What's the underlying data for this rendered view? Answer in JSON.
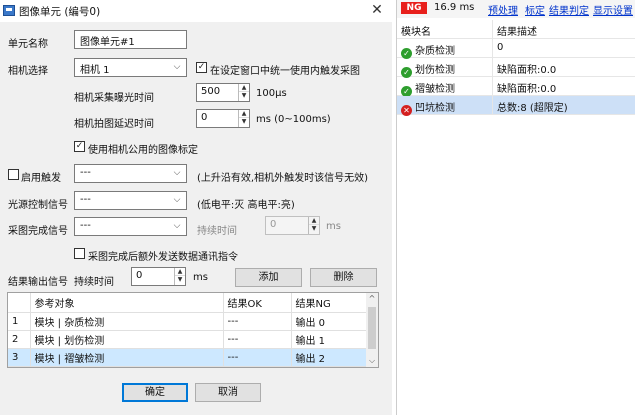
{
  "window": {
    "title": "图像单元 (编号0)",
    "close": "✕"
  },
  "form": {
    "unit_name_label": "单元名称",
    "unit_name_value": "图像单元#1",
    "camera_select_label": "相机选择",
    "camera_value": "相机 1",
    "trigger_mid_label": "在设定窗口中统一使用内触发采图",
    "trigger_mid_checked": true,
    "exposure_label": "相机采集曝光时间",
    "exposure_value": "500",
    "exposure_unit": "100μs",
    "delay_label": "相机拍图延迟时间",
    "delay_value": "0",
    "delay_unit": "ms (0~100ms)",
    "public_calib_label": "使用相机公用的图像标定",
    "public_calib_checked": true,
    "enable_trigger_label": "启用触发",
    "enable_trigger_checked": false,
    "trigger_value": "---",
    "trigger_hint": "(上升沿有效,相机外触发时该信号无效)",
    "light_label": "光源控制信号",
    "light_value": "---",
    "light_hint": "(低电平:灭  高电平:亮)",
    "done_label": "采图完成信号",
    "done_value": "---",
    "hold_label": "持续时间",
    "hold_value": "0",
    "hold_unit": "ms",
    "extra_send_label": "采图完成后额外发送数据通讯指令",
    "extra_send_checked": false,
    "output_label": "结果输出信号",
    "output_hold_label": "持续时间",
    "output_hold_value": "0",
    "output_hold_unit": "ms",
    "add_button": "添加",
    "delete_button": "删除"
  },
  "grid": {
    "columns": [
      "",
      "参考对象",
      "结果OK",
      "结果NG"
    ],
    "rows": [
      {
        "idx": "1",
        "ref": "模块 | 杂质检测",
        "ok": "---",
        "ng": "输出 0"
      },
      {
        "idx": "2",
        "ref": "模块 | 划伤检测",
        "ok": "---",
        "ng": "输出 1"
      },
      {
        "idx": "3",
        "ref": "模块 | 褶皱检测",
        "ok": "---",
        "ng": "输出 2"
      }
    ],
    "selected_row": 2
  },
  "footer": {
    "ok_button": "确定",
    "cancel_button": "取消"
  },
  "right_panel": {
    "status_badge": "NG",
    "time": "16.9 ms",
    "links": [
      "预处理",
      "标定",
      "结果判定",
      "显示设置"
    ],
    "columns": [
      "模块名",
      "结果描述"
    ],
    "rows": [
      {
        "status": "ok",
        "name": "杂质检测",
        "desc": "0"
      },
      {
        "status": "ok",
        "name": "划伤检测",
        "desc": "缺陷面积:0.0"
      },
      {
        "status": "ok",
        "name": "褶皱检测",
        "desc": "缺陷面积:0.0"
      },
      {
        "status": "ng",
        "name": "凹坑检测",
        "desc": "总数:8 (超限定)"
      }
    ],
    "colors": {
      "ng": "#e8201c",
      "ok": "#2e9e2e",
      "link": "#0033cc"
    }
  }
}
